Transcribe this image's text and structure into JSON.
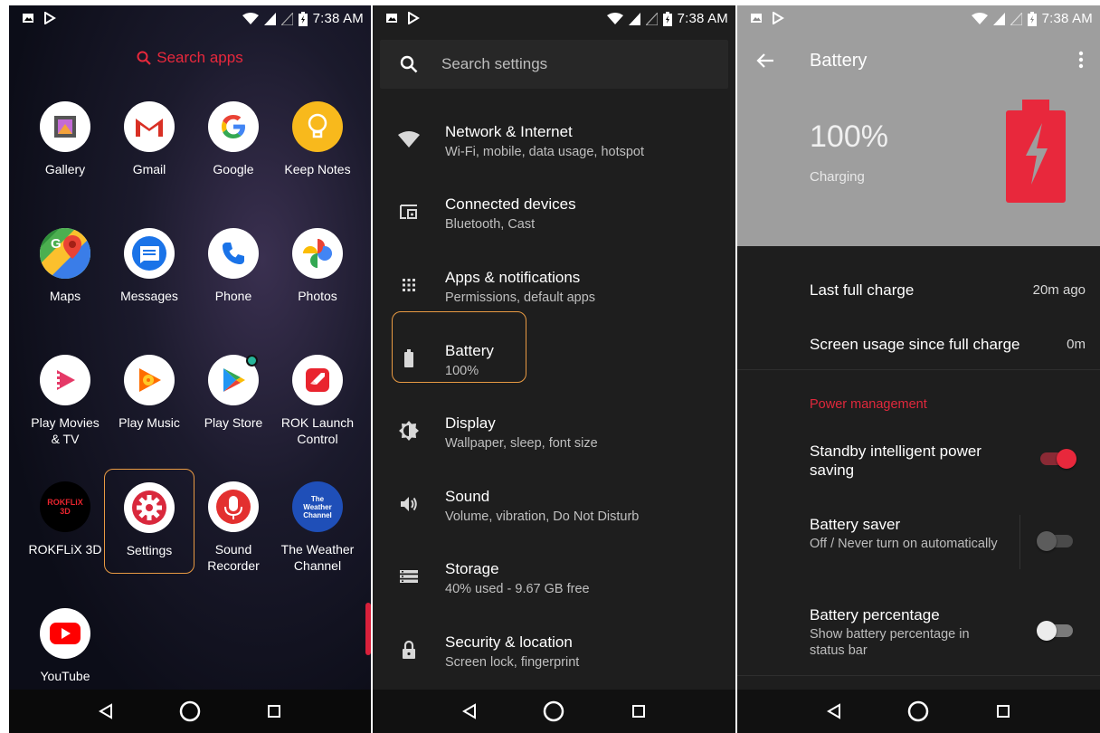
{
  "status": {
    "time": "7:38 AM"
  },
  "launcher": {
    "search_label": "Search apps",
    "apps": [
      {
        "label": "Gallery"
      },
      {
        "label": "Gmail"
      },
      {
        "label": "Google"
      },
      {
        "label": "Keep Notes"
      },
      {
        "label": "Maps"
      },
      {
        "label": "Messages"
      },
      {
        "label": "Phone"
      },
      {
        "label": "Photos"
      },
      {
        "label": "Play Movies\n& TV"
      },
      {
        "label": "Play Music"
      },
      {
        "label": "Play Store"
      },
      {
        "label": "ROK Launch\nControl"
      },
      {
        "label": "ROKFLiX 3D",
        "icon_text_1": "ROKFLiX",
        "icon_text_2": "3D"
      },
      {
        "label": "Settings"
      },
      {
        "label": "Sound\nRecorder"
      },
      {
        "label": "The Weather\nChannel",
        "icon_text_1": "The",
        "icon_text_2": "Weather",
        "icon_text_3": "Channel"
      },
      {
        "label": "YouTube"
      }
    ],
    "highlight_color": "#e89a43"
  },
  "settings": {
    "search_placeholder": "Search settings",
    "items": [
      {
        "title": "Network & Internet",
        "subtitle": "Wi-Fi, mobile, data usage, hotspot",
        "icon": "wifi-icon"
      },
      {
        "title": "Connected devices",
        "subtitle": "Bluetooth, Cast",
        "icon": "devices-icon"
      },
      {
        "title": "Apps & notifications",
        "subtitle": "Permissions, default apps",
        "icon": "apps-grid-icon"
      },
      {
        "title": "Battery",
        "subtitle": "100%",
        "icon": "battery-icon"
      },
      {
        "title": "Display",
        "subtitle": "Wallpaper, sleep, font size",
        "icon": "brightness-icon"
      },
      {
        "title": "Sound",
        "subtitle": "Volume, vibration, Do Not Disturb",
        "icon": "volume-icon"
      },
      {
        "title": "Storage",
        "subtitle": "40% used - 9.67 GB free",
        "icon": "storage-icon"
      },
      {
        "title": "Security & location",
        "subtitle": "Screen lock, fingerprint",
        "icon": "lock-icon"
      }
    ]
  },
  "battery": {
    "title": "Battery",
    "percent": "100%",
    "state": "Charging",
    "last_full_charge_label": "Last full charge",
    "last_full_charge_value": "20m ago",
    "screen_usage_label": "Screen usage since full charge",
    "screen_usage_value": "0m",
    "power_management_label": "Power management",
    "standby": {
      "title": "Standby intelligent power saving",
      "on": true
    },
    "saver": {
      "title": "Battery saver",
      "subtitle": "Off / Never turn on automatically",
      "on": false
    },
    "percentage": {
      "title": "Battery percentage",
      "subtitle": "Show battery percentage in status bar",
      "on": false
    },
    "accent": "#e0283c"
  }
}
